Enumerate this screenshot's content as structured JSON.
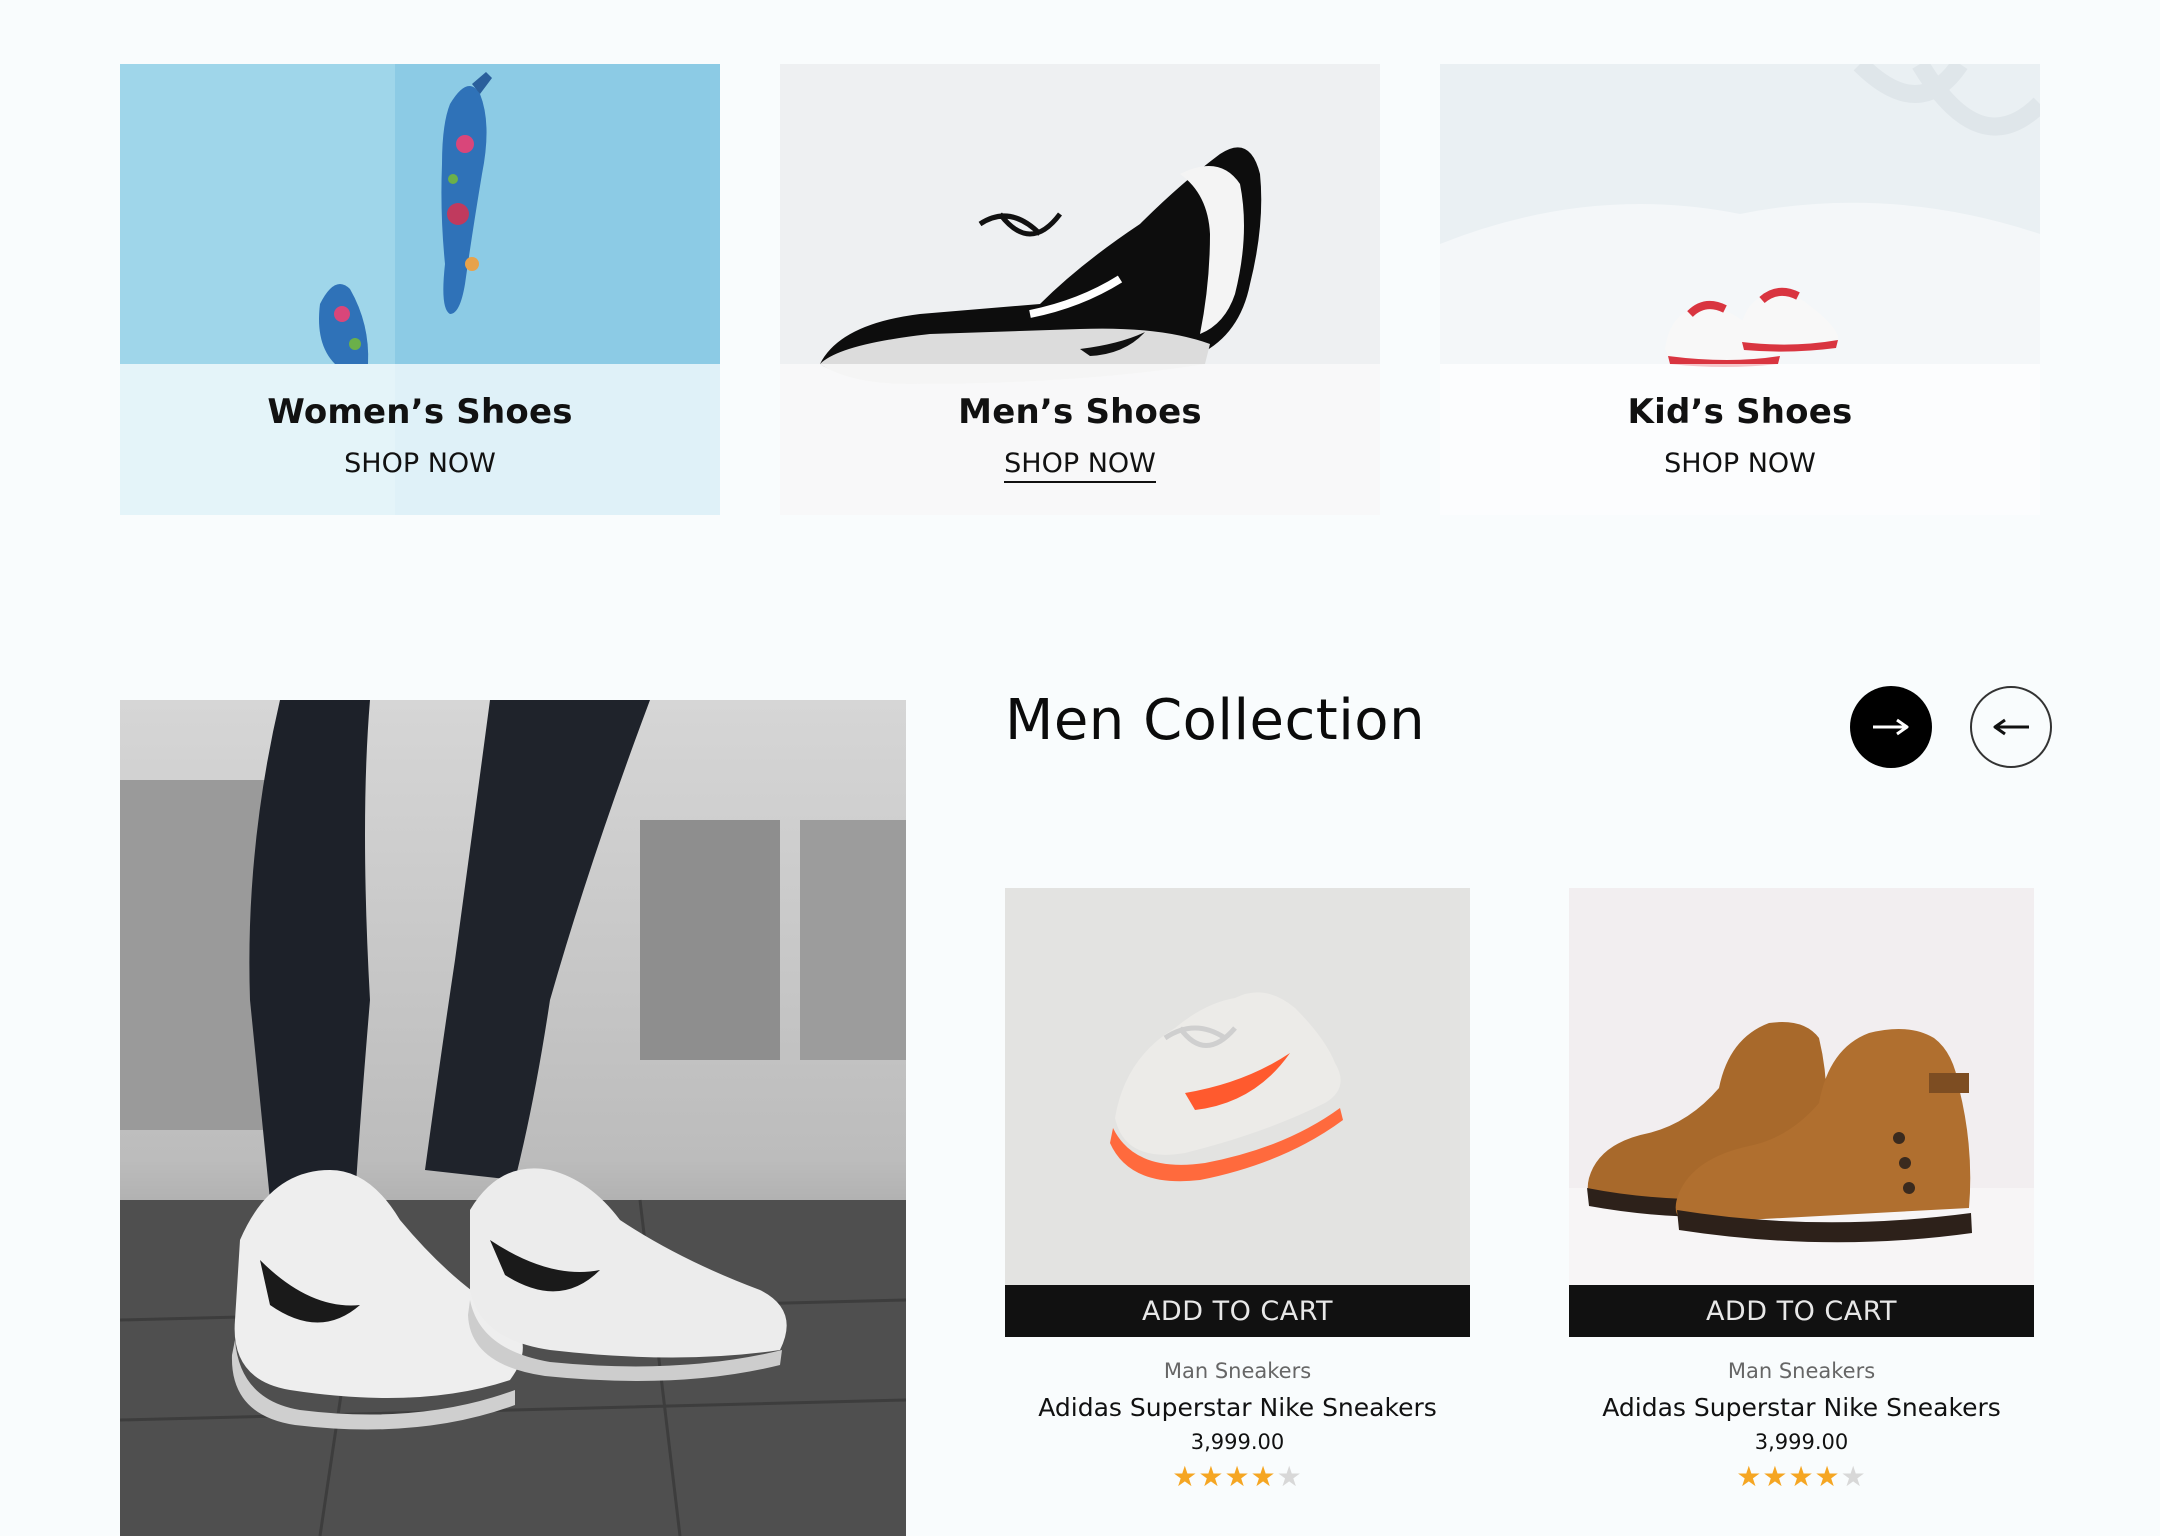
{
  "categories": [
    {
      "title": "Women’s Shoes",
      "link": "SHOP NOW"
    },
    {
      "title": "Men’s Shoes",
      "link": "SHOP NOW"
    },
    {
      "title": "Kid’s Shoes",
      "link": "SHOP NOW"
    }
  ],
  "collection": {
    "title": "Men Collection",
    "next_icon": "arrow-right-icon",
    "prev_icon": "arrow-left-icon"
  },
  "products": [
    {
      "category": "Man Sneakers",
      "name": "Adidas Superstar Nike Sneakers",
      "price": "3,999.00",
      "cta": "ADD TO CART",
      "rating": 4,
      "rating_max": 5
    },
    {
      "category": "Man Sneakers",
      "name": "Adidas Superstar Nike Sneakers",
      "price": "3,999.00",
      "cta": "ADD TO CART",
      "rating": 4,
      "rating_max": 5
    }
  ],
  "colors": {
    "page_bg": "#f9fcfd",
    "button_dark": "#111111",
    "star": "#f5a623",
    "star_empty": "#d8d8d8"
  }
}
